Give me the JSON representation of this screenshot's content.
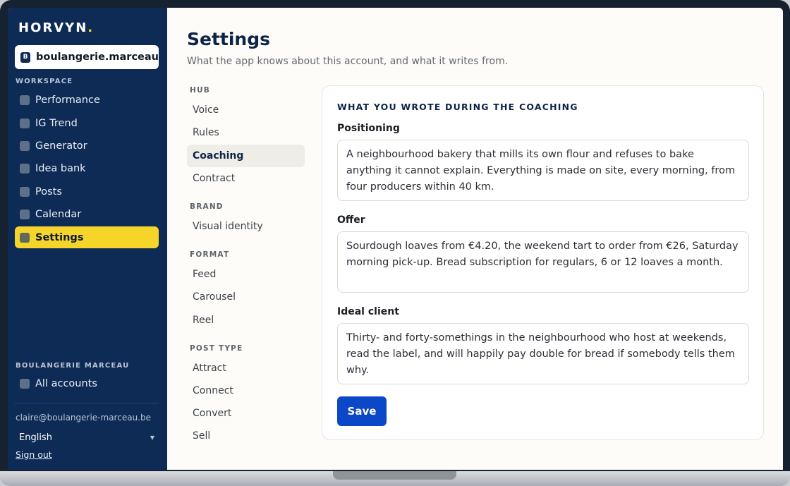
{
  "brand": {
    "name": "HORVYN",
    "dot": "."
  },
  "account": {
    "badge": "B",
    "name": "boulangerie.marceau"
  },
  "sidebar": {
    "workspace_label": "WORKSPACE",
    "items": [
      {
        "label": "Performance"
      },
      {
        "label": "IG Trend"
      },
      {
        "label": "Generator"
      },
      {
        "label": "Idea bank"
      },
      {
        "label": "Posts"
      },
      {
        "label": "Calendar"
      },
      {
        "label": "Settings",
        "active": true
      }
    ],
    "org_label": "BOULANGERIE MARCEAU",
    "all_accounts": "All accounts",
    "email": "claire@boulangerie-marceau.be",
    "language": "English",
    "sign_out": "Sign out"
  },
  "page": {
    "title": "Settings",
    "subtitle": "What the app knows about this account, and what it writes from."
  },
  "subnav": {
    "hub_label": "HUB",
    "hub": [
      "Voice",
      "Rules",
      "Coaching",
      "Contract"
    ],
    "active": "Coaching",
    "brand_label": "BRAND",
    "brand": [
      "Visual identity"
    ],
    "format_label": "FORMAT",
    "format": [
      "Feed",
      "Carousel",
      "Reel"
    ],
    "post_type_label": "POST TYPE",
    "post_type": [
      "Attract",
      "Connect",
      "Convert",
      "Sell"
    ]
  },
  "coaching": {
    "heading": "WHAT YOU WROTE DURING THE COACHING",
    "positioning_label": "Positioning",
    "positioning": "A neighbourhood bakery that mills its own flour and refuses to bake anything it cannot explain. Everything is made on site, every morning, from four producers within 40 km.",
    "offer_label": "Offer",
    "offer": "Sourdough loaves from €4.20, the weekend tart to order from €26, Saturday morning pick-up. Bread subscription for regulars, 6 or 12 loaves a month.",
    "ideal_client_label": "Ideal client",
    "ideal_client": "Thirty- and forty-somethings in the neighbourhood who host at weekends, read the label, and will happily pay double for bread if somebody tells them why.",
    "save_label": "Save"
  },
  "colors": {
    "sidebar_bg": "#0d2b55",
    "accent_yellow": "#f6d52b",
    "primary_button": "#0b47c6"
  }
}
